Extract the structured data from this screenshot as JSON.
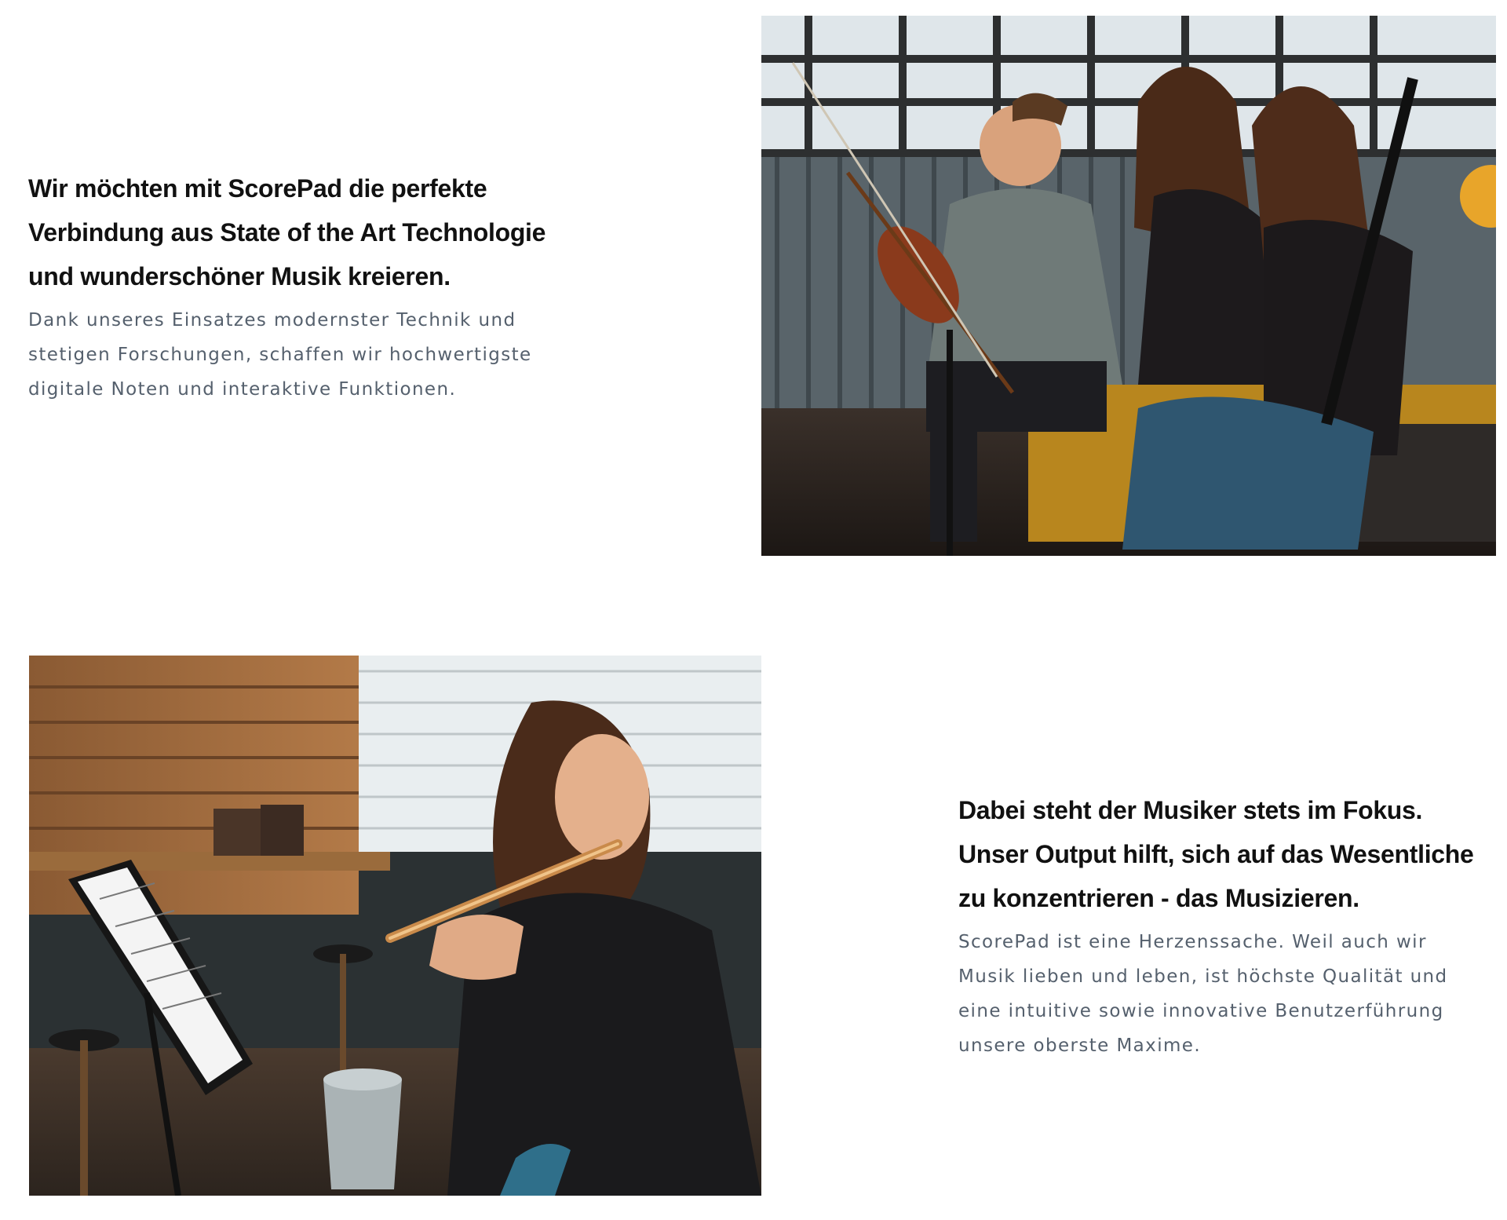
{
  "section_one": {
    "headline_lines": [
      "Wir möchten mit ScorePad die perfekte",
      "Verbindung aus State of the Art Technologie",
      "und  wunderschöner Musik kreieren."
    ],
    "body_lines": [
      "Dank unseres Einsatzes modernster Technik und",
      "stetigen Forschungen, schaffen wir hochwertigste",
      "digitale Noten und interaktive Funktionen."
    ]
  },
  "section_two": {
    "headline_lines": [
      "Dabei steht der Musiker stets im Fokus.",
      "Unser Output hilft, sich auf das Wesentliche",
      "zu konzentrieren - das Musizieren."
    ],
    "body_lines": [
      "ScorePad ist eine Herzenssache. Weil auch wir",
      "Musik lieben und leben, ist höchste Qualität und",
      "eine intuitive sowie innovative Benutzerführung",
      "unsere oberste Maxime."
    ]
  },
  "colors": {
    "headline": "#111111",
    "body": "#55606d",
    "background": "#ffffff"
  }
}
